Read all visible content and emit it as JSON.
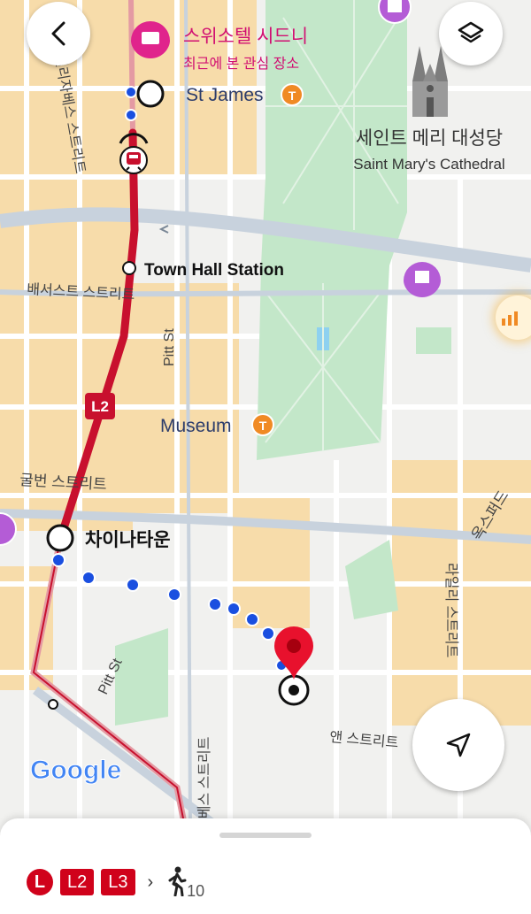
{
  "map": {
    "labels": {
      "hotel_name": "스위소텔 시드니",
      "hotel_sub": "최근에 본 관심 장소",
      "st_james": "St James",
      "cathedral_ko": "세인트 메리 대성당",
      "cathedral_en": "Saint Mary's Cathedral",
      "elizabeth_st": "엘리자베스 스트리트",
      "town_hall": "Town Hall Station",
      "bathurst_st": "배서스트 스트리트",
      "pitt_st": "Pitt St",
      "l2": "L2",
      "museum": "Museum",
      "goulburn_st": "굴번 스트리트",
      "chinatown": "차이나타운",
      "oxford_st": "옥스퍼드",
      "riley_st": "라일리 스트리트",
      "pitt_st_2": "Pitt St",
      "anne_st": "앤 스트리트",
      "chalmers_st": "차베스 스트리트",
      "google": "Google"
    },
    "transit_badge": "T",
    "colors": {
      "light_rail": "#c8102e",
      "walk_dots": "#1a4fe0",
      "park": "#c3e7c9",
      "urban": "#f7dcaa",
      "pin": "#e8112d",
      "poi_purple": "#b45cd6",
      "hotel_pink": "#e0248c",
      "transit_orange": "#f08a24"
    }
  },
  "controls": {
    "back": "back-icon",
    "layers": "layers-icon",
    "locate": "navigate-icon",
    "traffic": "traffic-icon"
  },
  "sheet": {
    "line_l": "L",
    "line_l2": "L2",
    "line_l3": "L3",
    "chevron": "›",
    "walk_minutes": "10"
  }
}
